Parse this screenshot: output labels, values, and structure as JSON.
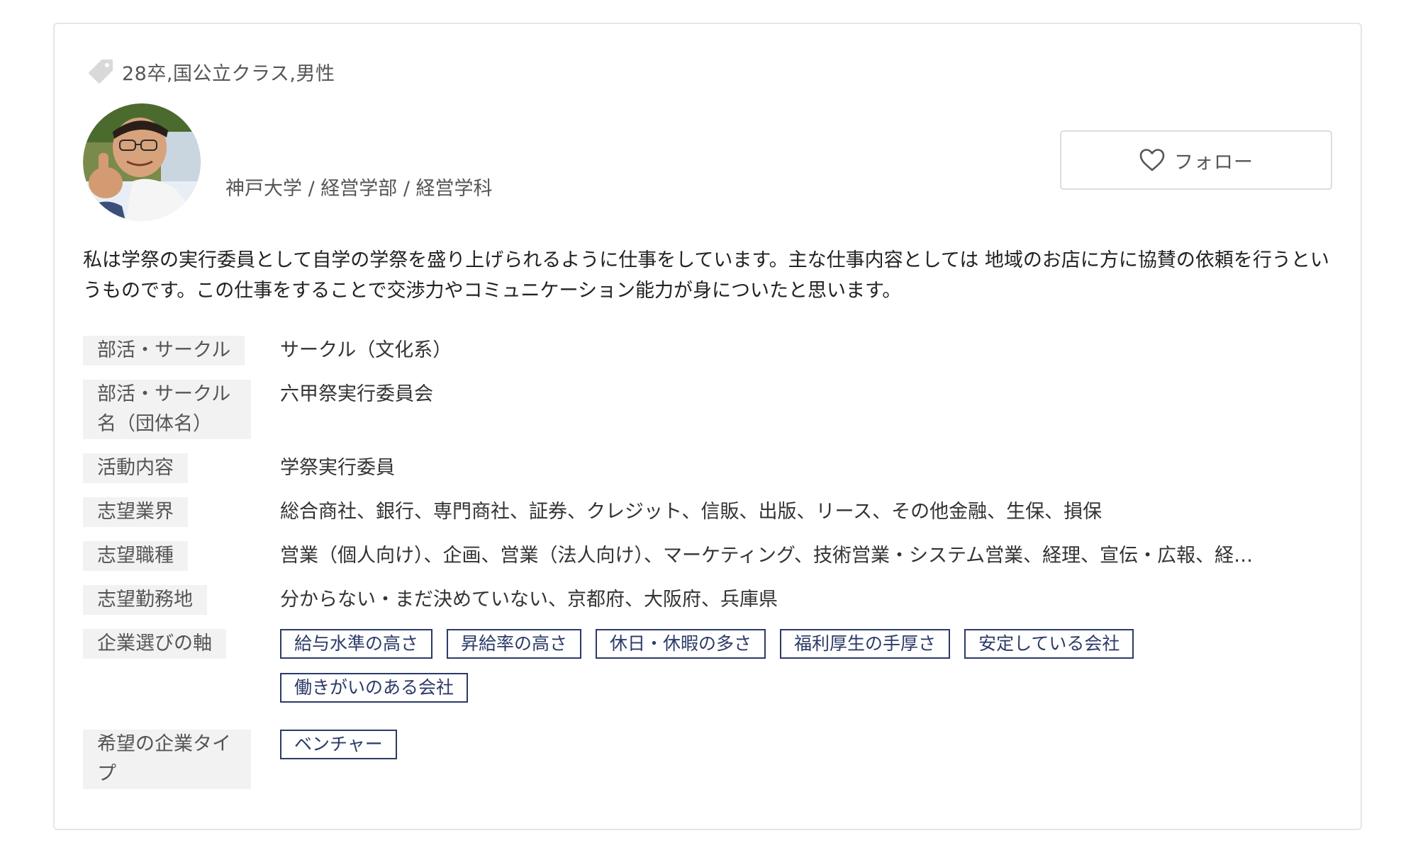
{
  "profile": {
    "tag_text": "28卒,国公立クラス,男性",
    "university": "神戸大学 / 経営学部 / 経営学科",
    "follow_label": "フォロー",
    "intro": "私は学祭の実行委員として自学の学祭を盛り上げられるように仕事をしています。主な仕事内容としては 地域のお店に方に協賛の依頼を行うというものです。この仕事をすることで交渉力やコミュニケーション能力が身についたと思います。"
  },
  "fields": {
    "club_type": {
      "label": "部活・サークル",
      "value": "サークル（文化系）"
    },
    "club_name": {
      "label": "部活・サークル名（団体名）",
      "value": "六甲祭実行委員会"
    },
    "activity": {
      "label": "活動内容",
      "value": "学祭実行委員"
    },
    "industry": {
      "label": "志望業界",
      "value": "総合商社、銀行、専門商社、証券、クレジット、信販、出版、リース、その他金融、生保、損保"
    },
    "job_type": {
      "label": "志望職種",
      "value": "営業（個人向け）、企画、営業（法人向け）、マーケティング、技術営業・システム営業、経理、宣伝・広報、経…"
    },
    "location": {
      "label": "志望勤務地",
      "value": "分からない・まだ決めていない、京都府、大阪府、兵庫県"
    },
    "company_axis": {
      "label": "企業選びの軸",
      "chips": [
        "給与水準の高さ",
        "昇給率の高さ",
        "休日・休暇の多さ",
        "福利厚生の手厚さ",
        "安定している会社",
        "働きがいのある会社"
      ]
    },
    "company_type": {
      "label": "希望の企業タイプ",
      "chips": [
        "ベンチャー"
      ]
    }
  },
  "colors": {
    "chip_border": "#2b3a67",
    "label_bg": "#f2f2f2",
    "card_border": "#e6e6e6"
  },
  "icons": {
    "tag": "tag-icon",
    "heart": "heart-icon"
  }
}
